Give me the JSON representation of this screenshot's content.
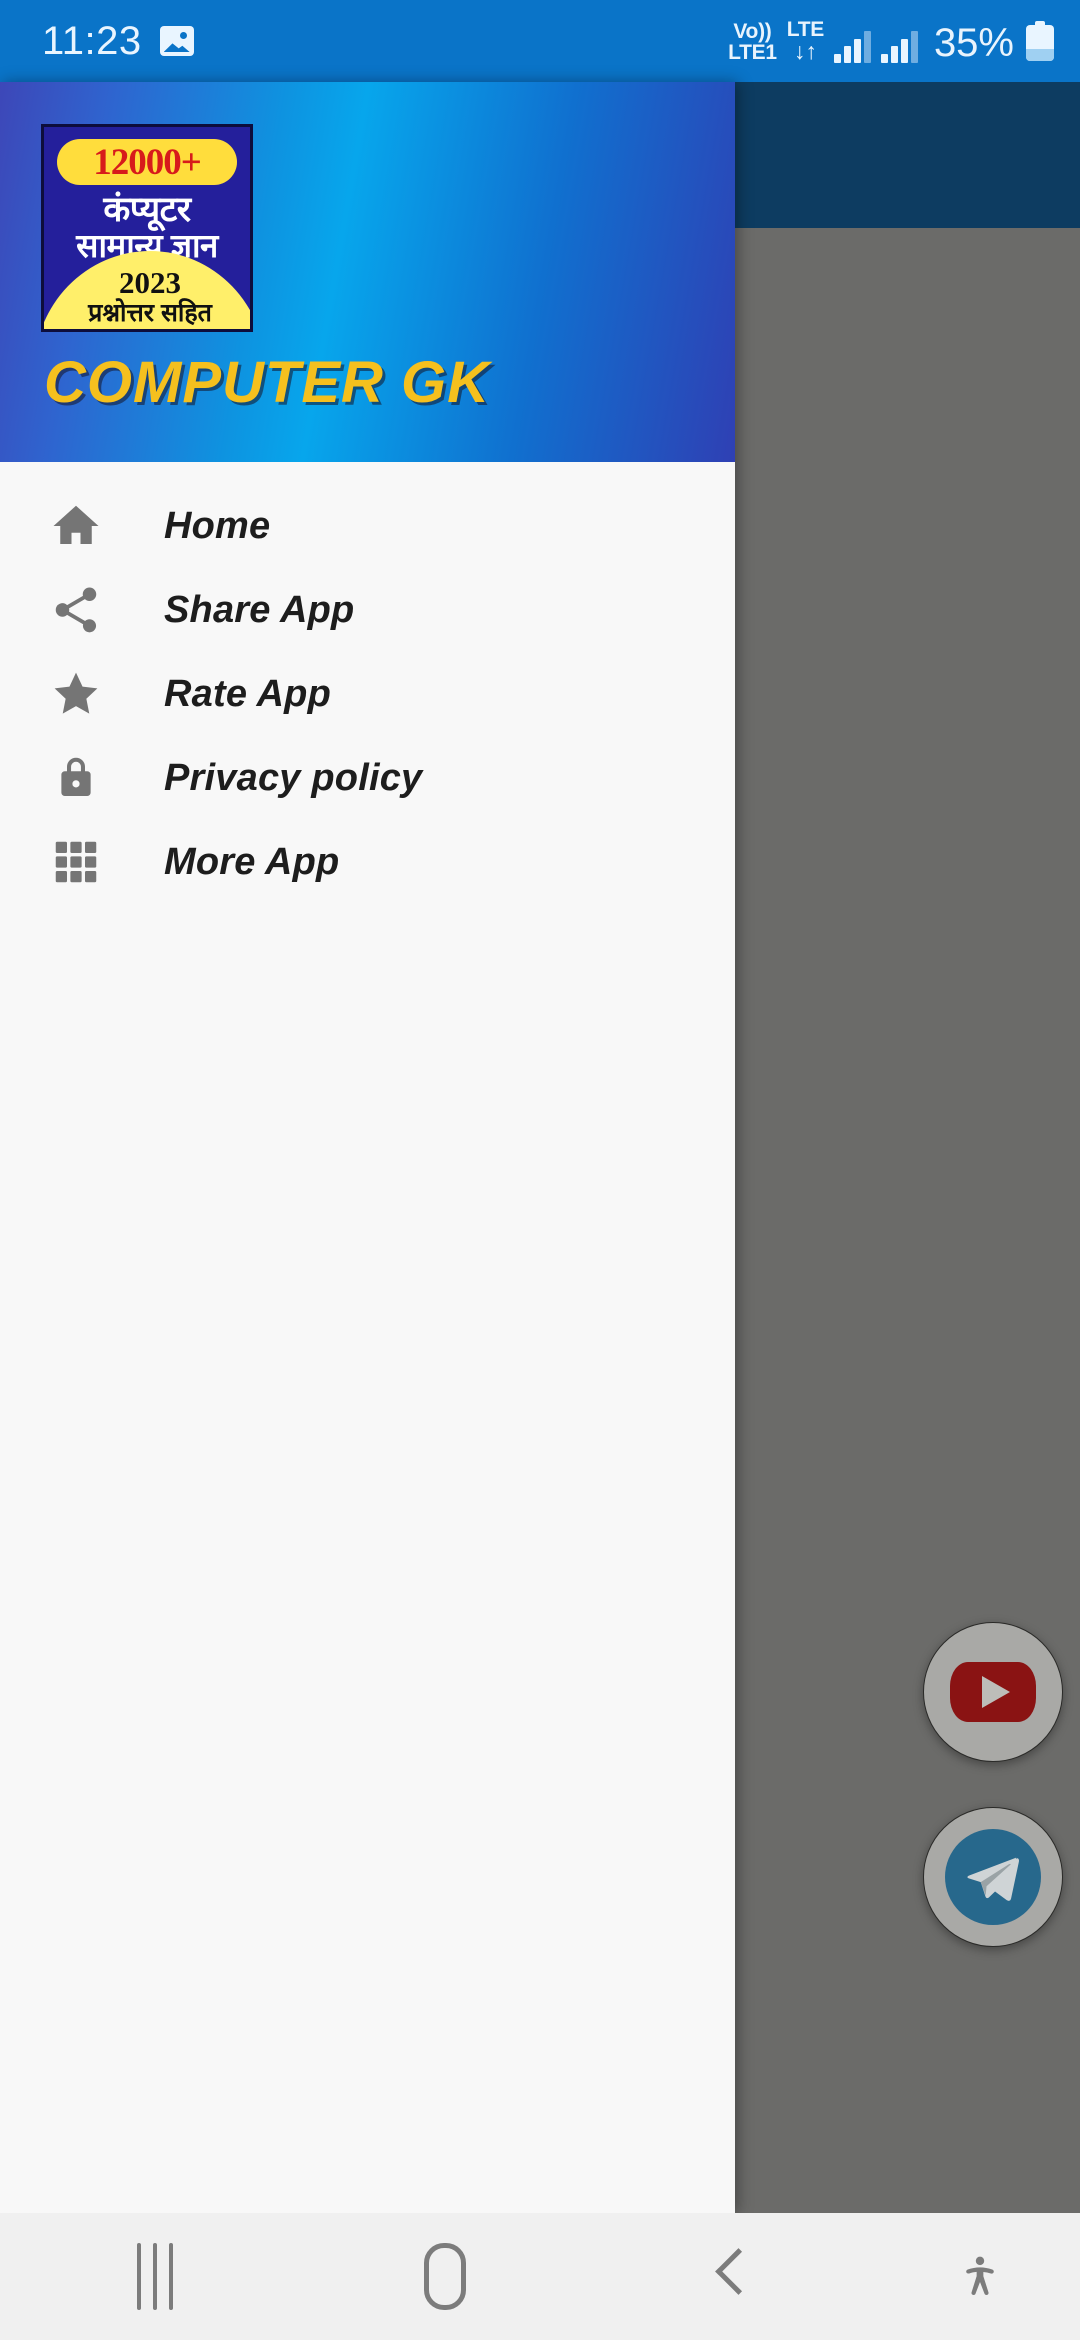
{
  "status_bar": {
    "time": "11:23",
    "photo_icon": "image-icon",
    "volte_top": "Vo))",
    "volte_bottom": "LTE1",
    "network_top": "LTE",
    "network_arrows": "↓↑",
    "signal_icon_1": "signal-bars-icon",
    "signal_icon_2": "signal-bars-icon",
    "battery_percent": "35%",
    "battery_icon": "battery-icon",
    "background_color": "#0a74c8"
  },
  "app_bar": {
    "background_color": "#0d3c61"
  },
  "scrim": {
    "background_color": "#6b6b69"
  },
  "drawer": {
    "header": {
      "title": "COMPUTER GK",
      "title_color": "#f5c01e",
      "logo": {
        "badge": "12000+",
        "line1": "कंप्यूटर",
        "line2": "सामान्य ज्ञान",
        "year": "2023",
        "subtitle": "प्रश्नोत्तर सहित",
        "badge_color": "#d71b1b",
        "background_color": "#241f9b"
      }
    },
    "items": [
      {
        "label": "Home",
        "icon": "home-icon"
      },
      {
        "label": "Share App",
        "icon": "share-icon"
      },
      {
        "label": "Rate App",
        "icon": "star-icon"
      },
      {
        "label": "Privacy policy",
        "icon": "lock-icon"
      },
      {
        "label": "More App",
        "icon": "grid-apps-icon"
      }
    ],
    "background_color": "#f8f8f8"
  },
  "fabs": [
    {
      "name": "youtube",
      "icon": "youtube-icon",
      "color": "#8a1313"
    },
    {
      "name": "telegram",
      "icon": "telegram-icon",
      "color": "#27688c"
    }
  ],
  "nav_bar": {
    "recents_icon": "recents-icon",
    "home_icon": "home-button-icon",
    "back_icon": "back-icon",
    "accessibility_icon": "accessibility-icon",
    "background_color": "#f0f0f0"
  }
}
